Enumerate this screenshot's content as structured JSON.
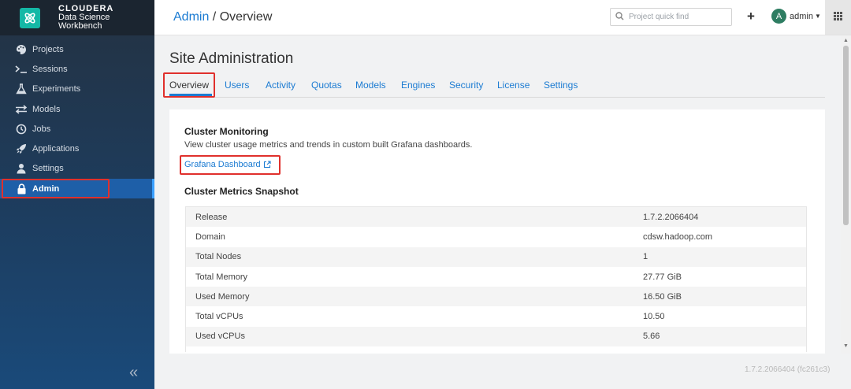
{
  "brand": {
    "line1": "CLOUDERA",
    "line2": "Data Science",
    "line3": "Workbench"
  },
  "sidebar": {
    "items": [
      {
        "label": "Projects",
        "icon": "palette-icon"
      },
      {
        "label": "Sessions",
        "icon": "terminal-icon"
      },
      {
        "label": "Experiments",
        "icon": "flask-icon"
      },
      {
        "label": "Models",
        "icon": "exchange-icon"
      },
      {
        "label": "Jobs",
        "icon": "clock-icon"
      },
      {
        "label": "Applications",
        "icon": "rocket-icon"
      },
      {
        "label": "Settings",
        "icon": "user-icon"
      },
      {
        "label": "Admin",
        "icon": "lock-icon",
        "active": true
      }
    ],
    "collapse_glyph": "«"
  },
  "header": {
    "crumb_link": "Admin",
    "crumb_sep": " / ",
    "crumb_current": "Overview",
    "search_placeholder": "Project quick find",
    "plus": "+",
    "avatar_letter": "A",
    "username": "admin"
  },
  "page": {
    "title": "Site Administration"
  },
  "tabs": [
    "Overview",
    "Users",
    "Activity",
    "Quotas",
    "Models",
    "Engines",
    "Security",
    "License",
    "Settings"
  ],
  "monitoring": {
    "heading": "Cluster Monitoring",
    "description": "View cluster usage metrics and trends in custom built Grafana dashboards.",
    "link": "Grafana Dashboard"
  },
  "snapshot": {
    "heading": "Cluster Metrics Snapshot",
    "rows": [
      {
        "key": "Release",
        "value": "1.7.2.2066404"
      },
      {
        "key": "Domain",
        "value": "cdsw.hadoop.com"
      },
      {
        "key": "Total Nodes",
        "value": "1"
      },
      {
        "key": "Total Memory",
        "value": "27.77 GiB"
      },
      {
        "key": "Used Memory",
        "value": "16.50 GiB"
      },
      {
        "key": "Total vCPUs",
        "value": "10.50"
      },
      {
        "key": "Used vCPUs",
        "value": "5.66"
      },
      {
        "key": "",
        "value": ""
      }
    ]
  },
  "footer": {
    "version": "1.7.2.2066404 (fc261c3)"
  },
  "colors": {
    "accent": "#1b7bd2",
    "highlight": "#e0302c",
    "sidebar": "#243242"
  }
}
